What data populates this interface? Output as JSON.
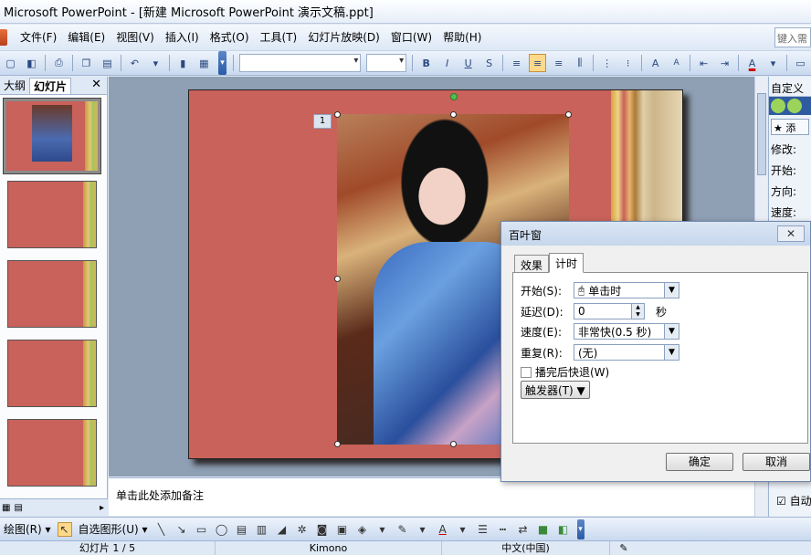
{
  "window": {
    "title": "Microsoft PowerPoint - [新建 Microsoft PowerPoint 演示文稿.ppt]",
    "help_search_placeholder": "键入需"
  },
  "menu": [
    "文件(F)",
    "编辑(E)",
    "视图(V)",
    "插入(I)",
    "格式(O)",
    "工具(T)",
    "幻灯片放映(D)",
    "窗口(W)",
    "帮助(H)"
  ],
  "toolbar": {
    "bold": "B",
    "italic": "I",
    "underline": "U",
    "shadow": "S",
    "grow_font": "A",
    "shrink_font": "A",
    "font_color": "A"
  },
  "left_pane": {
    "tab_outline": "大纲",
    "tab_slides": "幻灯片",
    "close": "✕",
    "slide_count": 5
  },
  "slide": {
    "animation_tag": "1"
  },
  "notes": {
    "placeholder": "单击此处添加备注"
  },
  "task_pane": {
    "title": "自定义",
    "add_effect": "添",
    "modify_label": "修改:",
    "start_label": "开始:",
    "direction_label": "方向:",
    "speed_label": "速度:",
    "autopreview": "自动"
  },
  "dialog": {
    "title": "百叶窗",
    "close": "✕",
    "tabs": [
      "效果",
      "计时"
    ],
    "active_tab": "计时",
    "start_label": "开始(S):",
    "start_value": "单击时",
    "delay_label": "延迟(D):",
    "delay_value": "0",
    "delay_unit": "秒",
    "speed_label": "速度(E):",
    "speed_value": "非常快(0.5 秒)",
    "repeat_label": "重复(R):",
    "repeat_value": "(无)",
    "rewind_label": "播完后快退(W)",
    "rewind_checked": false,
    "trigger_label": "触发器(T)",
    "ok": "确定",
    "cancel": "取消"
  },
  "drawing_toolbar": {
    "draw_label": "绘图(R)",
    "autoshapes_label": "自选图形(U)"
  },
  "status": {
    "slide_info": "幻灯片 1 / 5",
    "design": "Kimono",
    "language": "中文(中国)"
  }
}
